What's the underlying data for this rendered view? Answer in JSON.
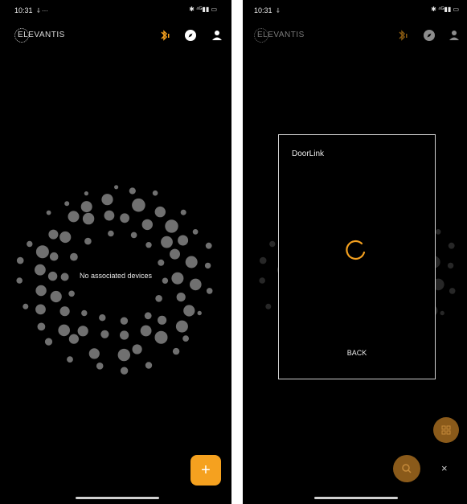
{
  "left_screen": {
    "status": {
      "time": "10:31",
      "left_icons": "⸸ ···",
      "right_icons": "✱ ⁴ᴳ▮▮ ▭"
    },
    "header": {
      "logo_text": "ELEVANTIS"
    },
    "empty_message": "No associated devices",
    "fab_label": "+"
  },
  "right_screen": {
    "status": {
      "time": "10:31",
      "left_icons": "⸸",
      "right_icons": "✱ ⁴ᴳ▮▮ ▭"
    },
    "header": {
      "logo_text": "ELEVANTIS"
    },
    "dialog": {
      "title": "DoorLink",
      "back_label": "BACK"
    },
    "close_label": "×"
  },
  "colors": {
    "accent": "#f5a11f",
    "background": "#000000",
    "dots": "#707070"
  },
  "icons": [
    "bluetooth-icon",
    "compass-icon",
    "user-icon",
    "plus-icon",
    "qr-icon",
    "search-icon",
    "close-icon",
    "spinner-icon"
  ]
}
